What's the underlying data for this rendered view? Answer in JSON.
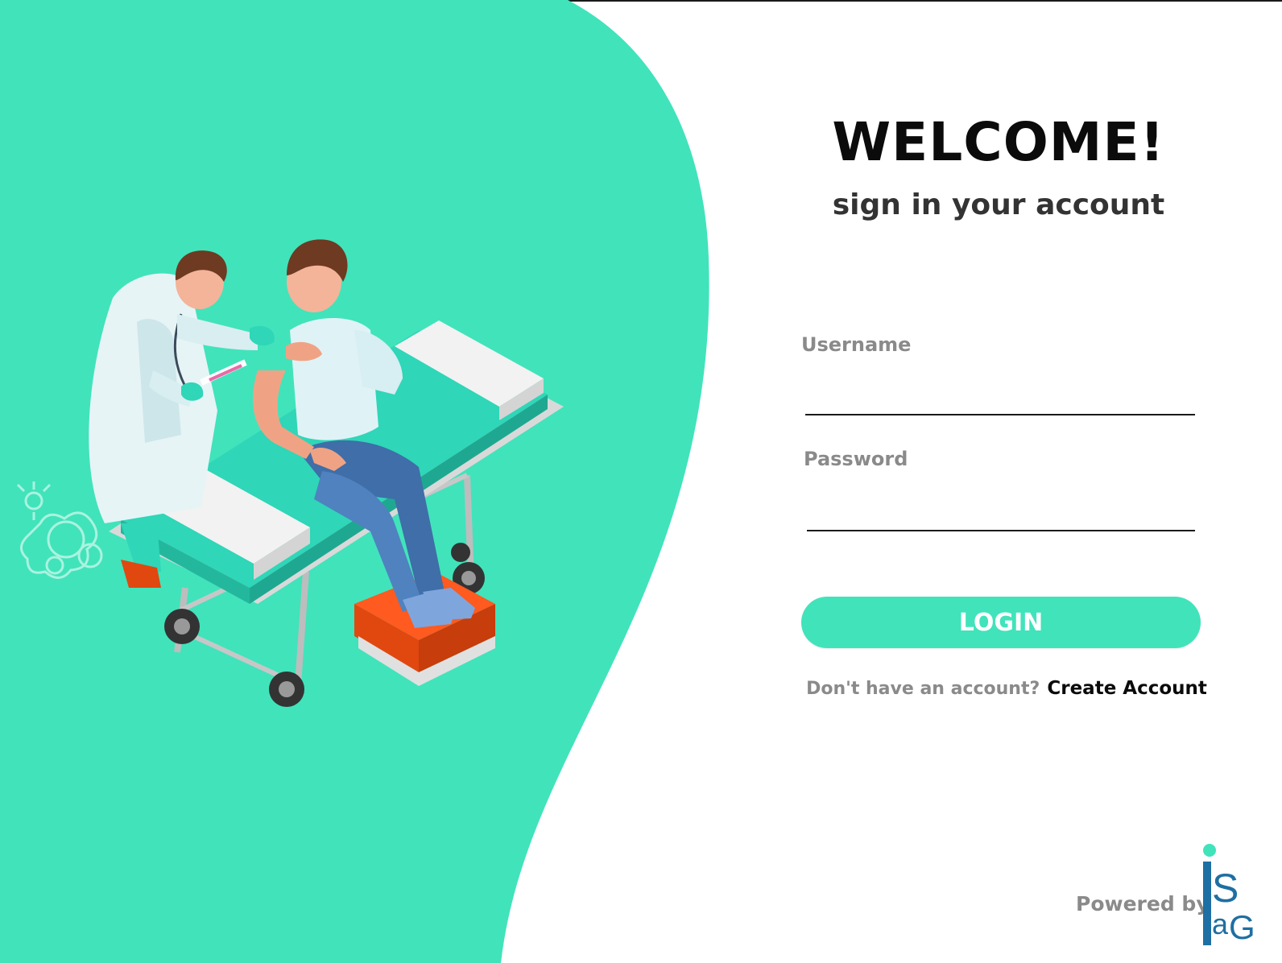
{
  "welcome": {
    "title": "WELCOME!",
    "subtitle": "sign in your account"
  },
  "form": {
    "username_label": "Username",
    "username_value": "",
    "password_label": "Password",
    "password_value": "",
    "login_label": "LOGIN"
  },
  "signup": {
    "prompt": "Don't have an account?",
    "link_label": "Create Account"
  },
  "footer": {
    "powered_by": "Powered by",
    "logo_name": "isaG-logo"
  },
  "illustration": {
    "name": "doctor-vaccinating-patient-illustration"
  },
  "colors": {
    "accent": "#41e3bb",
    "title": "#0b0b0b",
    "muted_text": "#8a8a8a",
    "logo_blue": "#1e6fa3"
  }
}
